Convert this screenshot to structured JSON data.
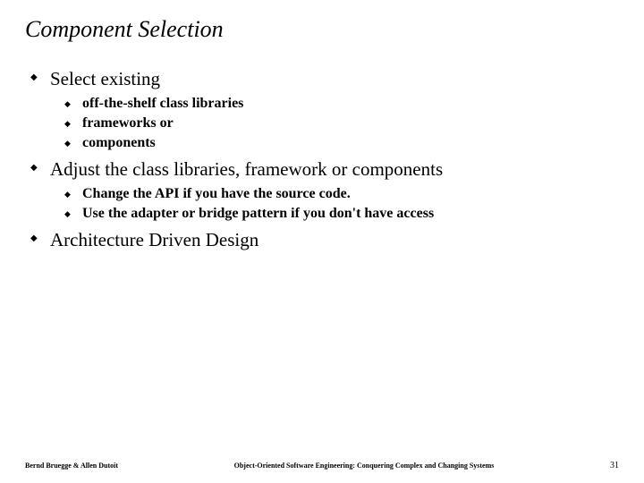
{
  "title": "Component Selection",
  "bullets": {
    "b0": {
      "text": "Select existing",
      "sub": [
        "off-the-shelf class libraries",
        " frameworks or",
        "components"
      ]
    },
    "b1": {
      "text": "Adjust the class libraries, framework or components",
      "sub": [
        "Change the API if you have the source code.",
        "Use the adapter or bridge pattern if you don't have access"
      ]
    },
    "b2": {
      "text": "Architecture Driven Design"
    }
  },
  "footer": {
    "left": "Bernd Bruegge & Allen Dutoit",
    "center": "Object-Oriented Software Engineering: Conquering Complex and Changing Systems",
    "right": "31"
  }
}
